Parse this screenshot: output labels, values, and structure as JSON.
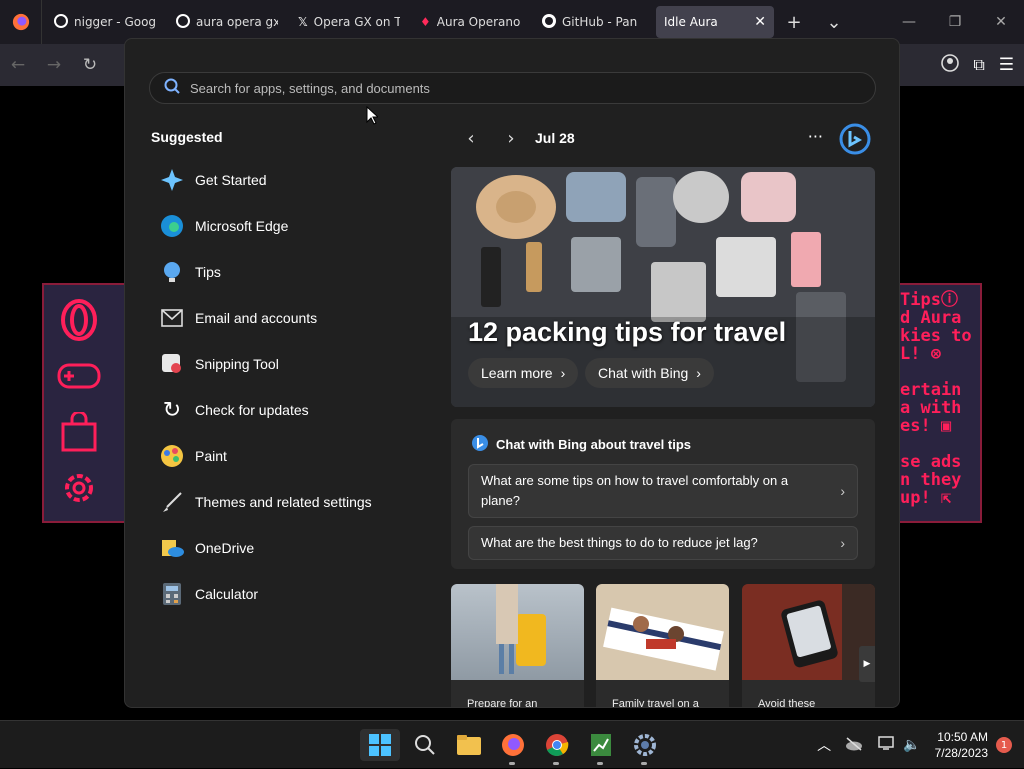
{
  "browser": {
    "tabs": [
      {
        "label": "nigger - Goog"
      },
      {
        "label": "aura opera gx"
      },
      {
        "label": "Opera GX on T"
      },
      {
        "label": "Aura Operano"
      },
      {
        "label": "GitHub - Pan"
      },
      {
        "label": "Idle Aura"
      }
    ]
  },
  "extension_right": {
    "lines": [
      "Tipsⓘ",
      "d Aura",
      "kies to",
      "L! ⊗",
      "",
      "ertain",
      "a with",
      "es! ▣",
      "",
      "se ads",
      "n they",
      "up! ⇱"
    ]
  },
  "start_menu": {
    "search_placeholder": "Search for apps, settings, and documents",
    "suggested_title": "Suggested",
    "suggested": [
      {
        "label": "Get Started",
        "icon": "get-started-icon"
      },
      {
        "label": "Microsoft Edge",
        "icon": "edge-icon"
      },
      {
        "label": "Tips",
        "icon": "tips-icon"
      },
      {
        "label": "Email and accounts",
        "icon": "mail-icon"
      },
      {
        "label": "Snipping Tool",
        "icon": "snipping-icon"
      },
      {
        "label": "Check for updates",
        "icon": "refresh-icon"
      },
      {
        "label": "Paint",
        "icon": "paint-icon"
      },
      {
        "label": "Themes and related settings",
        "icon": "brush-icon"
      },
      {
        "label": "OneDrive",
        "icon": "onedrive-icon"
      },
      {
        "label": "Calculator",
        "icon": "calculator-icon"
      }
    ],
    "feed": {
      "date": "Jul 28",
      "hero_title": "12 packing tips for travel",
      "learn_more": "Learn more",
      "chat_with_bing": "Chat with Bing",
      "chat_title": "Chat with Bing about travel tips",
      "questions": [
        "What are some tips on how to travel comfortably on a plane?",
        "What are the best things to do to reduce jet lag?"
      ],
      "cards": [
        "Prepare for an",
        "Family travel on a",
        "Avoid these"
      ]
    }
  },
  "taskbar": {
    "time": "10:50 AM",
    "date": "7/28/2023",
    "notifications": "1"
  },
  "colors": {
    "accent": "#ff1f5a",
    "panel": "#202020"
  }
}
